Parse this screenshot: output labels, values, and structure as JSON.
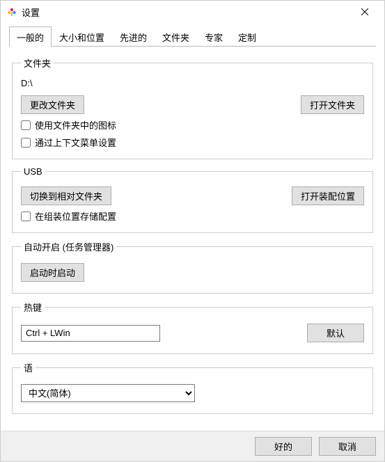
{
  "window": {
    "title": "设置"
  },
  "tabs": [
    {
      "label": "一般的",
      "active": true
    },
    {
      "label": "大小和位置",
      "active": false
    },
    {
      "label": "先进的",
      "active": false
    },
    {
      "label": "文件夹",
      "active": false
    },
    {
      "label": "专家",
      "active": false
    },
    {
      "label": "定制",
      "active": false
    }
  ],
  "folder_group": {
    "legend": "文件夹",
    "path": "D:\\",
    "change_button": "更改文件夹",
    "open_button": "打开文件夹",
    "chk_use_icons": "使用文件夹中的图标",
    "chk_context_menu": "通过上下文菜单设置"
  },
  "usb_group": {
    "legend": "USB",
    "switch_button": "切换到相对文件夹",
    "open_assembly_button": "打开装配位置",
    "chk_store_cfg": "在组装位置存储配置"
  },
  "autostart_group": {
    "legend": "自动开启 (任务管理器)",
    "start_button": "启动时启动"
  },
  "hotkey_group": {
    "legend": "热键",
    "value": "Ctrl + LWin",
    "default_button": "默认"
  },
  "language_group": {
    "legend": "语",
    "selected": "中文(简体)"
  },
  "footer": {
    "ok": "好的",
    "cancel": "取消"
  }
}
